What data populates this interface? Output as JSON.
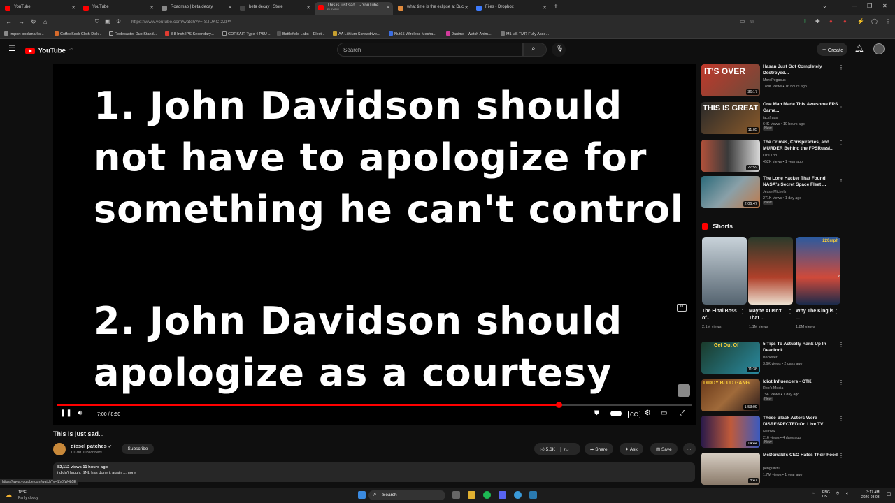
{
  "browser": {
    "tabs": [
      {
        "label": "YouTube",
        "color": "#ff0000"
      },
      {
        "label": "YouTube",
        "color": "#ff0000"
      },
      {
        "label": "Roadmap | beta decay",
        "color": "#888888"
      },
      {
        "label": "beta decay | Store",
        "color": "#444444"
      },
      {
        "label": "This is just sad... - YouTube",
        "sublabel": "PLAYING",
        "color": "#ff0000"
      },
      {
        "label": "what time is the eclipse at Duc",
        "color": "#e08a3c"
      },
      {
        "label": "Files - Dropbox",
        "color": "#3d7bfd"
      }
    ],
    "url": "https://www.youtube.com/watch?v=-SJUKC-2ZPA",
    "bookmarks": [
      {
        "label": "Import bookmarks...",
        "color": "#8a8a8a"
      },
      {
        "label": "CoffeeSock Cloth Disk...",
        "color": "#d66a2b"
      },
      {
        "label": "Rodecaster Duo Stand...",
        "color": "#333333"
      },
      {
        "label": "8.8 Inch IPS Secondary...",
        "color": "#e03c31"
      },
      {
        "label": "CORSAIR Type 4 PSU ...",
        "color": "#222222"
      },
      {
        "label": "Battlefield Labs – Elect...",
        "color": "#555555"
      },
      {
        "label": "AA Lithium Screwdrive...",
        "color": "#c7a02f"
      },
      {
        "label": "Nut65 Wireless Mecha...",
        "color": "#3c6ee0"
      },
      {
        "label": "9anime - Watch Anim...",
        "color": "#d33b9c"
      },
      {
        "label": "M1 VS TMR Fully Asse...",
        "color": "#777777"
      }
    ]
  },
  "youtube": {
    "logo_text": "YouTube",
    "logo_region": "CA",
    "search_placeholder": "Search",
    "create_label": "Create"
  },
  "video": {
    "line1": "1. John Davidson should",
    "line2": "not have to apologize for",
    "line3": "something he can't control",
    "line4": "2. John Davidson should",
    "line5": "apologize as a courtesy",
    "time": "7:00 / 8:50",
    "progress": 0.79,
    "title": "This is just sad...",
    "channel": "diesel patches",
    "subscribers": "1.07M subscribers",
    "subscribe_label": "Subscribe",
    "likes": "5.6K",
    "share_label": "Share",
    "ask_label": "Ask",
    "save_label": "Save",
    "views_meta": "82,112 views  11 hours ago",
    "description": "i didn't laugh, SNL has done it again ...more"
  },
  "recommendations_top": [
    {
      "title": "Hasan Just Got Completely Destroyed...",
      "channel": "MorePegasus",
      "meta": "189K views • 16 hours ago",
      "duration": "36:17",
      "thumb_text": "IT'S OVER",
      "thumb_color": "#c0392b"
    },
    {
      "title": "One Man Made This Awesome FPS Game...",
      "channel": "jackfrags",
      "meta": "64K views • 10 hours ago",
      "badge": "New",
      "duration": "11:05",
      "thumb_text": "THIS IS GREAT",
      "thumb_color": "#7a4a2a"
    },
    {
      "title": "The Crimes, Conspiracies, and MURDER Behind the FPSRussi...",
      "channel": "Dire Trip",
      "meta": "452K views • 1 year ago",
      "duration": "27:59",
      "thumb_text": "",
      "thumb_color": "#4a3a33"
    },
    {
      "title": "The Lone Hacker That Found NASA's Secret Space Fleet ...",
      "channel": "Jesse Michels",
      "meta": "271K views • 1 day ago",
      "badge": "New",
      "duration": "2:06:47",
      "thumb_text": "",
      "thumb_color": "#3b5a6a"
    }
  ],
  "shorts_header": "Shorts",
  "shorts": [
    {
      "title": "The Final Boss of...",
      "views": "2.1M views",
      "color": "#6b7a86"
    },
    {
      "title": "Maybe AI Isn't That ...",
      "views": "1.1M views",
      "color": "#7a3a2c"
    },
    {
      "title": "Why The King is ...",
      "views": "1.8M views",
      "color": "#2a5a9a"
    }
  ],
  "recommendations_bottom": [
    {
      "title": "5 Tips To Actually Rank Up In Deadlock",
      "channel": "Brickster",
      "meta": "3.6K views • 2 days ago",
      "duration": "11:38",
      "thumb_text": "Get Out Of",
      "thumb_color": "#3a5f4a"
    },
    {
      "title": "Idiot Influencers - OTK",
      "channel": "Rob's Media",
      "meta": "75K views • 1 day ago",
      "badge": "New",
      "duration": "1:53:09",
      "thumb_text": "DIDDY BLUD GANG",
      "thumb_color": "#5a3a2a"
    },
    {
      "title": "These Black Actors Were DISRESPECTED On Live TV",
      "channel": "Nelrock",
      "meta": "216 views • 4 days ago",
      "badge": "New",
      "duration": "14:44",
      "thumb_text": "",
      "thumb_color": "#3a2a5a"
    },
    {
      "title": "McDonald's CEO Hates Their Food",
      "channel": "penguinz0",
      "meta": "1.7M views • 1 year ago",
      "duration": "8:47",
      "thumb_text": "",
      "thumb_color": "#8a7a6a"
    }
  ],
  "taskbar": {
    "weather_temp": "18°F",
    "weather_desc": "Partly cloudy",
    "search_label": "Search",
    "lang_top": "ENG",
    "lang_bottom": "US",
    "time": "3:17 AM",
    "date": "2026-03-03"
  },
  "status_url": "https://www.youtube.com/watch?v=fZv0tW4b5E"
}
